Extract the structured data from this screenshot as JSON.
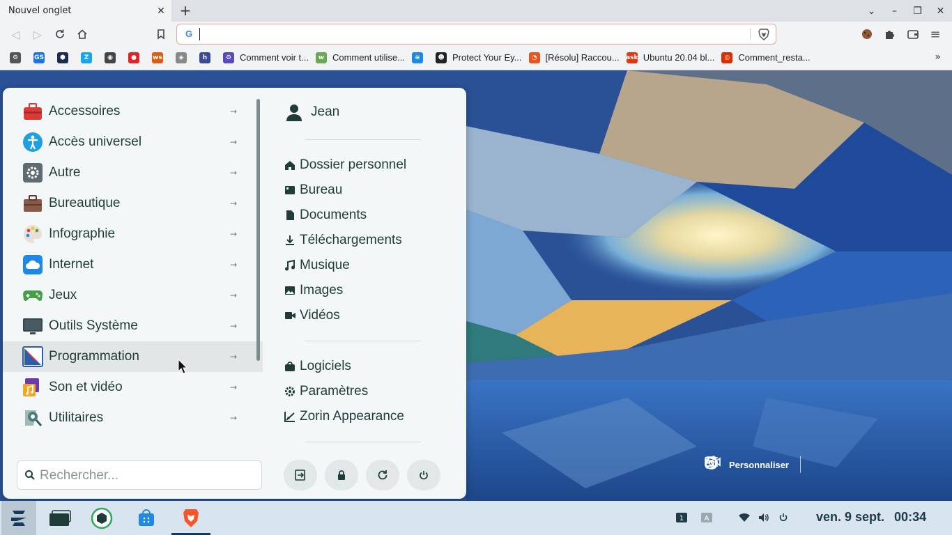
{
  "browser": {
    "tab_title": "Nouvel onglet",
    "url_value": "",
    "bookmarks": [
      {
        "label": "",
        "icon": "gear-icon",
        "color": "#555555"
      },
      {
        "label": "",
        "icon": "google-sheets-icon",
        "color": "#1a73e8"
      },
      {
        "label": "",
        "icon": "hex-icon",
        "color": "#1b2d4f"
      },
      {
        "label": "",
        "icon": "zorin-icon",
        "color": "#15a6f0"
      },
      {
        "label": "",
        "icon": "globe-icon",
        "color": "#444444"
      },
      {
        "label": "",
        "icon": "red-leaf-icon",
        "color": "#e02424"
      },
      {
        "label": "",
        "icon": "news-icon",
        "color": "#e05a10"
      },
      {
        "label": "",
        "icon": "shield-icon",
        "color": "#888888"
      },
      {
        "label": "",
        "icon": "h-icon",
        "color": "#3a4a9a"
      },
      {
        "label": "Comment voir t...",
        "icon": "gear-purple-icon",
        "color": "#5a4ab8"
      },
      {
        "label": "Comment utilise...",
        "icon": "green-logo-icon",
        "color": "#6aa84f"
      },
      {
        "label": "",
        "icon": "blue-logo-icon",
        "color": "#1e88e5"
      },
      {
        "label": "Protect Your Ey...",
        "icon": "tux-icon",
        "color": "#222222"
      },
      {
        "label": "[Résolu] Raccou...",
        "icon": "ubuntu-fr-icon",
        "color": "#e95420"
      },
      {
        "label": "Ubuntu 20.04 bl...",
        "icon": "askubuntu-icon",
        "color": "#e8340e"
      },
      {
        "label": "Comment_resta...",
        "icon": "ubuntu-icon",
        "color": "#dd2c00"
      }
    ]
  },
  "menu": {
    "categories": [
      {
        "label": "Accessoires",
        "icon": "toolbox-icon",
        "color": "#d93b3b"
      },
      {
        "label": "Accès universel",
        "icon": "accessibility-icon",
        "color": "#1e9fe0"
      },
      {
        "label": "Autre",
        "icon": "gear-icon",
        "color": "#5f6b73"
      },
      {
        "label": "Bureautique",
        "icon": "briefcase-icon",
        "color": "#8a5a48"
      },
      {
        "label": "Infographie",
        "icon": "palette-icon",
        "color": "#e8e0d4"
      },
      {
        "label": "Internet",
        "icon": "cloud-icon",
        "color": "#1e88e5"
      },
      {
        "label": "Jeux",
        "icon": "gamepad-icon",
        "color": "#43a047"
      },
      {
        "label": "Outils Système",
        "icon": "monitor-icon",
        "color": "#37474f"
      },
      {
        "label": "Programmation",
        "icon": "code-icon",
        "color": "#2a5db0"
      },
      {
        "label": "Son et vidéo",
        "icon": "music-video-icon",
        "color": "#f5a623"
      },
      {
        "label": "Utilitaires",
        "icon": "utilities-icon",
        "color": "#4a7b7a"
      }
    ],
    "hovered_index": 8,
    "user_name": "Jean",
    "places": [
      {
        "label": "Dossier personnel",
        "icon": "home-icon"
      },
      {
        "label": "Bureau",
        "icon": "desktop-icon"
      },
      {
        "label": "Documents",
        "icon": "document-icon"
      },
      {
        "label": "Téléchargements",
        "icon": "download-icon"
      },
      {
        "label": "Musique",
        "icon": "music-icon"
      },
      {
        "label": "Images",
        "icon": "image-icon"
      },
      {
        "label": "Vidéos",
        "icon": "video-icon"
      }
    ],
    "system": [
      {
        "label": "Logiciels",
        "icon": "software-bag-icon"
      },
      {
        "label": "Paramètres",
        "icon": "settings-gear-icon"
      },
      {
        "label": "Zorin Appearance",
        "icon": "appearance-icon"
      }
    ],
    "search_placeholder": "Rechercher..."
  },
  "desktop": {
    "customize_label": "Personnaliser"
  },
  "taskbar": {
    "date": "ven. 9 sept.",
    "time": "00:34"
  }
}
